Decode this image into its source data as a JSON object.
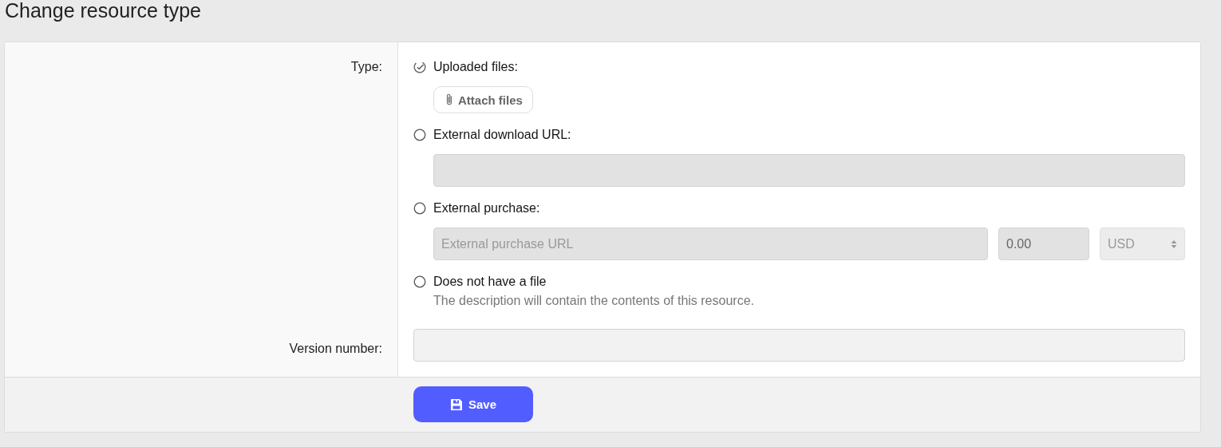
{
  "page_title": "Change resource type",
  "type_field": {
    "label": "Type:",
    "options": [
      {
        "kind": "upload",
        "label": "Uploaded files:",
        "selected": true,
        "button": "Attach files"
      },
      {
        "kind": "url",
        "label": "External download URL:",
        "selected": false,
        "url_field": {
          "disabled": true
        }
      },
      {
        "kind": "purchase",
        "label": "External purchase:",
        "selected": false,
        "url_field": {
          "placeholder": "External purchase URL",
          "disabled": true
        },
        "price_field": {
          "value": "0.00",
          "disabled": true
        },
        "currency_select": {
          "value": "USD",
          "disabled": true
        }
      },
      {
        "kind": "none",
        "label": "Does not have a file",
        "selected": false,
        "hint": "The description will contain the contents of this resource."
      }
    ]
  },
  "version_field": {
    "label": "Version number:"
  },
  "save_button": {
    "label": "Save"
  }
}
